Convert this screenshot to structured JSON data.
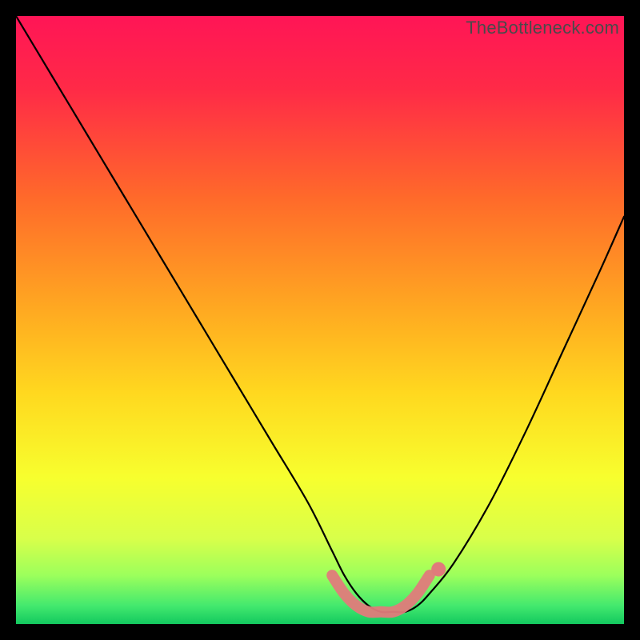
{
  "watermark": "TheBottleneck.com",
  "chart_data": {
    "type": "line",
    "title": "",
    "xlabel": "",
    "ylabel": "",
    "xlim": [
      0,
      100
    ],
    "ylim": [
      0,
      100
    ],
    "grid": false,
    "legend": false,
    "series": [
      {
        "name": "bottleneck-curve",
        "x": [
          0,
          6,
          12,
          18,
          24,
          30,
          36,
          42,
          48,
          52,
          54,
          56,
          58,
          60,
          62,
          64,
          66,
          68,
          72,
          78,
          84,
          90,
          96,
          100
        ],
        "values": [
          100,
          90,
          80,
          70,
          60,
          50,
          40,
          30,
          20,
          12,
          8,
          5,
          3,
          2,
          2,
          2,
          3,
          5,
          10,
          20,
          32,
          45,
          58,
          67
        ]
      },
      {
        "name": "highlight-band",
        "x": [
          52,
          54,
          56,
          58,
          60,
          62,
          64,
          66,
          68
        ],
        "values": [
          8,
          5,
          3,
          2,
          2,
          2,
          3,
          5,
          8
        ]
      }
    ],
    "gradient_stops": [
      {
        "pct": 0,
        "color": "#ff1556"
      },
      {
        "pct": 12,
        "color": "#ff2a47"
      },
      {
        "pct": 30,
        "color": "#ff6a2a"
      },
      {
        "pct": 48,
        "color": "#ffa821"
      },
      {
        "pct": 62,
        "color": "#ffd81f"
      },
      {
        "pct": 76,
        "color": "#f7ff2e"
      },
      {
        "pct": 86,
        "color": "#d8ff4a"
      },
      {
        "pct": 92,
        "color": "#9cff5c"
      },
      {
        "pct": 97,
        "color": "#43e96e"
      },
      {
        "pct": 100,
        "color": "#13c95f"
      }
    ]
  }
}
